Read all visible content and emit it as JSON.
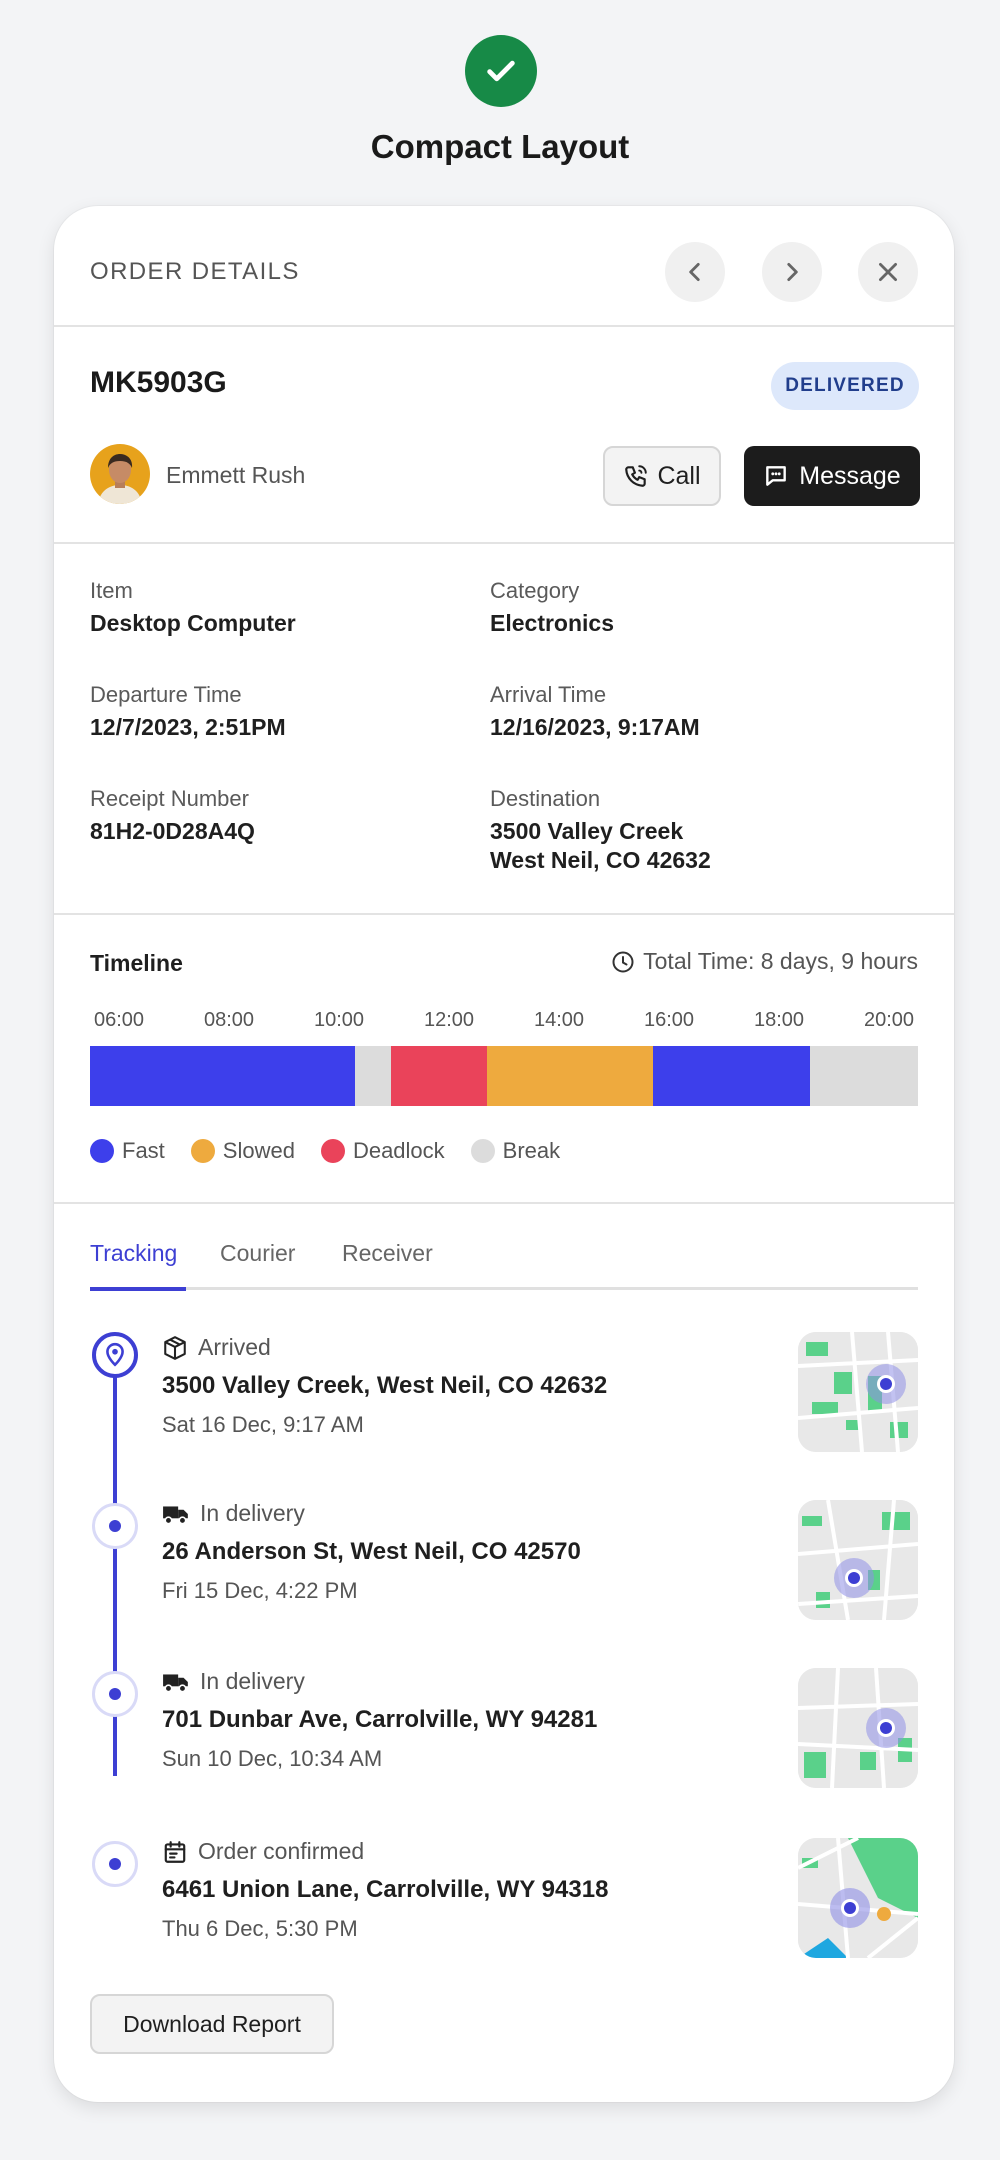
{
  "page": {
    "heading": "Compact Layout"
  },
  "header": {
    "title": "ORDER DETAILS"
  },
  "order": {
    "id": "MK5903G",
    "status": "DELIVERED",
    "status_color": "#213e8c",
    "person": "Emmett Rush",
    "call_label": "Call",
    "message_label": "Message"
  },
  "details": {
    "item_label": "Item",
    "item": "Desktop Computer",
    "category_label": "Category",
    "category": "Electronics",
    "departure_label": "Departure Time",
    "departure": "12/7/2023, 2:51PM",
    "arrival_label": "Arrival Time",
    "arrival": "12/16/2023, 9:17AM",
    "receipt_label": "Receipt Number",
    "receipt": "81H2-0D28A4Q",
    "destination_label": "Destination",
    "destination_line1": "3500 Valley Creek",
    "destination_line2": "West Neil, CO 42632"
  },
  "timeline": {
    "title": "Timeline",
    "total": "Total Time: 8 days, 9 hours",
    "ticks": [
      "06:00",
      "08:00",
      "10:00",
      "12:00",
      "14:00",
      "16:00",
      "18:00",
      "20:00"
    ],
    "range_hours": [
      6,
      21
    ],
    "segments": [
      {
        "type": "Fast",
        "start": 6.0,
        "end": 10.8
      },
      {
        "type": "Break",
        "start": 10.8,
        "end": 11.45
      },
      {
        "type": "Deadlock",
        "start": 11.45,
        "end": 13.2
      },
      {
        "type": "Slowed",
        "start": 13.2,
        "end": 16.2
      },
      {
        "type": "Fast",
        "start": 16.2,
        "end": 19.05
      },
      {
        "type": "Break",
        "start": 19.05,
        "end": 21.0
      }
    ],
    "legend": [
      {
        "name": "Fast",
        "color": "#3d3feb"
      },
      {
        "name": "Slowed",
        "color": "#eeaa3e"
      },
      {
        "name": "Deadlock",
        "color": "#ea435a"
      },
      {
        "name": "Break",
        "color": "#dcdcdc"
      }
    ]
  },
  "tabs": [
    {
      "label": "Tracking",
      "active": true
    },
    {
      "label": "Courier",
      "active": false
    },
    {
      "label": "Receiver",
      "active": false
    }
  ],
  "tracking": [
    {
      "status": "Arrived",
      "icon": "package-icon",
      "address": "3500 Valley Creek, West Neil, CO 42632",
      "time": "Sat 16 Dec, 9:17 AM"
    },
    {
      "status": "In delivery",
      "icon": "truck-icon",
      "address": "26 Anderson St, West Neil, CO 42570",
      "time": "Fri 15 Dec, 4:22 PM"
    },
    {
      "status": "In delivery",
      "icon": "truck-icon",
      "address": "701 Dunbar Ave, Carrolville, WY 94281",
      "time": "Sun 10 Dec, 10:34 AM"
    },
    {
      "status": "Order confirmed",
      "icon": "calendar-icon",
      "address": "6461 Union Lane, Carrolville, WY 94318",
      "time": "Thu 6 Dec, 5:30 PM"
    }
  ],
  "actions": {
    "download_label": "Download Report"
  },
  "colors": {
    "accent": "#3d3fd3",
    "success": "#178a47"
  }
}
